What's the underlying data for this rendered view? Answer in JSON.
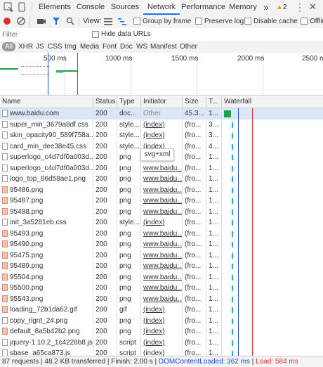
{
  "tabs": [
    {
      "label": "Elements",
      "active": false
    },
    {
      "label": "Console",
      "active": false
    },
    {
      "label": "Sources",
      "active": false
    },
    {
      "label": "Network",
      "active": true
    },
    {
      "label": "Performance",
      "active": false
    },
    {
      "label": "Memory",
      "active": false
    }
  ],
  "more_tabs": "»",
  "warnings_count": "2",
  "toolbar": {
    "view_label": "View:",
    "group_by_frame": "Group by frame",
    "preserve_log": "Preserve log",
    "disable_cache": "Disable cache",
    "offline": "Offline"
  },
  "filter": {
    "placeholder": "Filter",
    "hide_data_urls": "Hide data URLs"
  },
  "types": [
    "All",
    "XHR",
    "JS",
    "CSS",
    "Img",
    "Media",
    "Font",
    "Doc",
    "WS",
    "Manifest",
    "Other"
  ],
  "overview_ticks": [
    "500 ms",
    "1000 ms",
    "1500 ms",
    "2000 ms",
    "2500 m"
  ],
  "columns": {
    "name": "Name",
    "status": "Status",
    "type": "Type",
    "initiator": "Initiator",
    "size": "Size",
    "time": "T...",
    "waterfall": "Waterfall"
  },
  "rows": [
    {
      "name": "www.baidu.com",
      "status": "200",
      "type": "doc...",
      "initiator": "Other",
      "size": "45.3...",
      "time": "1...",
      "icon": "doc",
      "wf": 0.0
    },
    {
      "name": "super_min_3679a8df.css",
      "status": "200",
      "type": "style...",
      "initiator": "(index)",
      "size": "(fro...",
      "time": "3...",
      "icon": "doc",
      "wf": 0.1
    },
    {
      "name": "skin_opacity90_589f758a....",
      "status": "200",
      "type": "style...",
      "initiator": "(index)",
      "size": "(fro...",
      "time": "3...",
      "icon": "doc",
      "wf": 0.1
    },
    {
      "name": "card_min_dee38e45.css",
      "status": "200",
      "type": "style...",
      "initiator": "(index)",
      "size": "(fro...",
      "time": "4...",
      "icon": "doc",
      "wf": 0.1
    },
    {
      "name": "superlogo_c4d7df0a003d...",
      "status": "200",
      "type": "png",
      "initiator": "(index)",
      "size": "(fro...",
      "time": "1...",
      "icon": "doc",
      "wf": 0.1
    },
    {
      "name": "superlogo_c4d7df0a003d...",
      "status": "200",
      "type": "png",
      "initiator": "www.baidu...",
      "size": "(fro...",
      "time": "1...",
      "icon": "doc",
      "wf": 0.1
    },
    {
      "name": "logo_top_86d58ae1.png",
      "status": "200",
      "type": "png",
      "initiator": "www.baidu...",
      "size": "(fro...",
      "time": "1...",
      "icon": "doc",
      "wf": 0.1
    },
    {
      "name": "95486.png",
      "status": "200",
      "type": "png",
      "initiator": "www.baidu...",
      "size": "(fro...",
      "time": "1...",
      "icon": "img",
      "wf": 0.1
    },
    {
      "name": "95487.png",
      "status": "200",
      "type": "png",
      "initiator": "www.baidu...",
      "size": "(fro...",
      "time": "1...",
      "icon": "img",
      "wf": 0.1
    },
    {
      "name": "95488.png",
      "status": "200",
      "type": "png",
      "initiator": "www.baidu...",
      "size": "(fro...",
      "time": "1...",
      "icon": "img",
      "wf": 0.1
    },
    {
      "name": "init_3a5281eb.css",
      "status": "200",
      "type": "style...",
      "initiator": "(index)",
      "size": "(fro...",
      "time": "1...",
      "icon": "doc",
      "wf": 0.1
    },
    {
      "name": "95493.png",
      "status": "200",
      "type": "png",
      "initiator": "www.baidu...",
      "size": "(fro...",
      "time": "1...",
      "icon": "img",
      "wf": 0.1
    },
    {
      "name": "95490.png",
      "status": "200",
      "type": "png",
      "initiator": "www.baidu...",
      "size": "(fro...",
      "time": "1...",
      "icon": "img",
      "wf": 0.1
    },
    {
      "name": "95475.png",
      "status": "200",
      "type": "png",
      "initiator": "www.baidu...",
      "size": "(fro...",
      "time": "1...",
      "icon": "img",
      "wf": 0.1
    },
    {
      "name": "95489.png",
      "status": "200",
      "type": "png",
      "initiator": "www.baidu...",
      "size": "(fro...",
      "time": "1...",
      "icon": "img",
      "wf": 0.1
    },
    {
      "name": "95504.png",
      "status": "200",
      "type": "png",
      "initiator": "www.baidu...",
      "size": "(fro...",
      "time": "1...",
      "icon": "img",
      "wf": 0.1
    },
    {
      "name": "95500.png",
      "status": "200",
      "type": "png",
      "initiator": "www.baidu...",
      "size": "(fro...",
      "time": "1...",
      "icon": "img",
      "wf": 0.1
    },
    {
      "name": "95543.png",
      "status": "200",
      "type": "png",
      "initiator": "www.baidu...",
      "size": "(fro...",
      "time": "1...",
      "icon": "img",
      "wf": 0.1
    },
    {
      "name": "loading_72b1da62.gif",
      "status": "200",
      "type": "gif",
      "initiator": "(index)",
      "size": "(fro...",
      "time": "1...",
      "icon": "img",
      "wf": 0.1
    },
    {
      "name": "copy_rignt_24.png",
      "status": "200",
      "type": "png",
      "initiator": "(index)",
      "size": "(fro...",
      "time": "1...",
      "icon": "doc",
      "wf": 0.1
    },
    {
      "name": "default_8a5b42b2.png",
      "status": "200",
      "type": "png",
      "initiator": "(index)",
      "size": "(fro...",
      "time": "1...",
      "icon": "img",
      "wf": 0.1
    },
    {
      "name": "jquery-1.10.2_1c4228b8.js",
      "status": "200",
      "type": "script",
      "initiator": "(index)",
      "size": "(fro...",
      "time": "1...",
      "icon": "doc",
      "wf": 0.1
    },
    {
      "name": "sbase_a65ca873.js",
      "status": "200",
      "type": "script",
      "initiator": "(index)",
      "size": "(fro...",
      "time": "1...",
      "icon": "doc",
      "wf": 0.1
    }
  ],
  "tooltip": "svg+xml",
  "status_bar": {
    "requests": "87 requests | 48.2 KB transferred | Finish: 2.00 s | ",
    "dcl": "DOMContentLoaded: 362 ms",
    "sep": " | ",
    "load": "Load: 584 ms"
  },
  "colors": {
    "accent": "#1a73e8",
    "record": "#d93025",
    "dcl": "#1a4fd6",
    "load": "#d33",
    "waterfall": "#27a8d6",
    "doc_bar": "#1ea446"
  }
}
